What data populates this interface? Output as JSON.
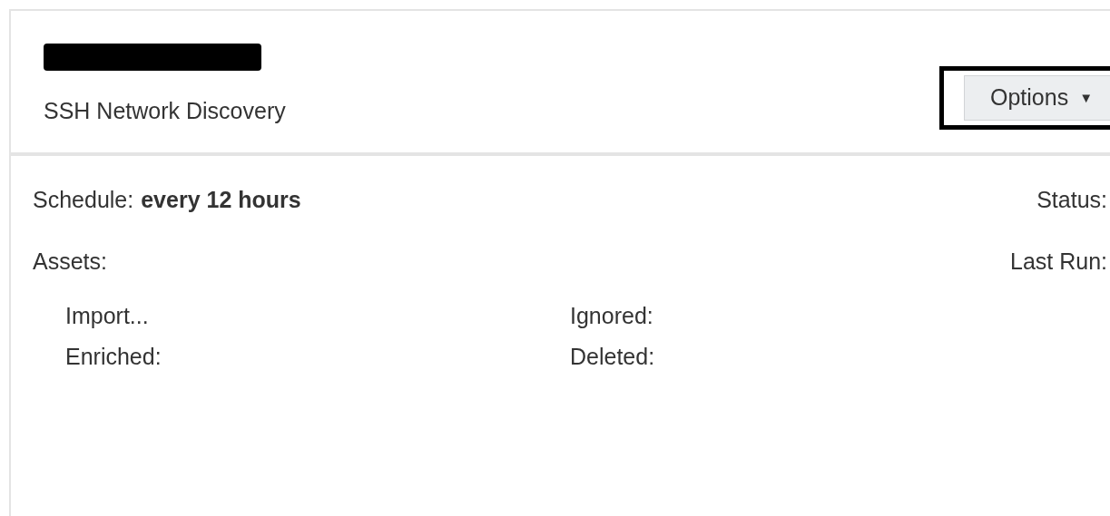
{
  "header": {
    "subtitle": "SSH Network Discovery",
    "options_button": {
      "label": "Options",
      "caret": "▼"
    }
  },
  "summary": {
    "schedule_label": "Schedule:",
    "schedule_value": "every 12 hours",
    "status_label": "Status:",
    "assets_label": "Assets:",
    "last_run_label": "Last Run:"
  },
  "asset_counts": [
    {
      "label": "Import..."
    },
    {
      "label": "Ignored:"
    },
    {
      "label": "Enriched:"
    },
    {
      "label": "Deleted:"
    }
  ]
}
